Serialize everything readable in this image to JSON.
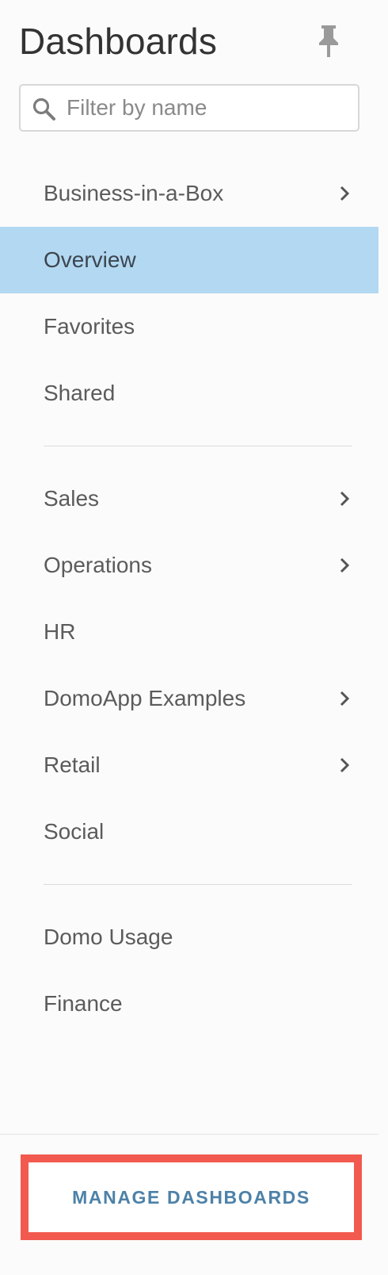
{
  "header": {
    "title": "Dashboards",
    "pin_icon": "pin-icon"
  },
  "search": {
    "placeholder": "Filter by name",
    "value": "",
    "icon": "search-icon"
  },
  "nav": {
    "group1": [
      {
        "label": "Business-in-a-Box",
        "has_children": true,
        "active": false
      },
      {
        "label": "Overview",
        "has_children": false,
        "active": true
      },
      {
        "label": "Favorites",
        "has_children": false,
        "active": false
      },
      {
        "label": "Shared",
        "has_children": false,
        "active": false
      }
    ],
    "group2": [
      {
        "label": "Sales",
        "has_children": true,
        "active": false
      },
      {
        "label": "Operations",
        "has_children": true,
        "active": false
      },
      {
        "label": "HR",
        "has_children": false,
        "active": false
      },
      {
        "label": "DomoApp Examples",
        "has_children": true,
        "active": false
      },
      {
        "label": "Retail",
        "has_children": true,
        "active": false
      },
      {
        "label": "Social",
        "has_children": false,
        "active": false
      }
    ],
    "group3": [
      {
        "label": "Domo Usage",
        "has_children": false,
        "active": false
      },
      {
        "label": "Finance",
        "has_children": false,
        "active": false
      }
    ]
  },
  "footer": {
    "manage_label": "MANAGE DASHBOARDS"
  },
  "colors": {
    "active_bg": "#b3d8f1",
    "highlight_border": "#f25a4f",
    "button_text": "#4d81a8"
  }
}
